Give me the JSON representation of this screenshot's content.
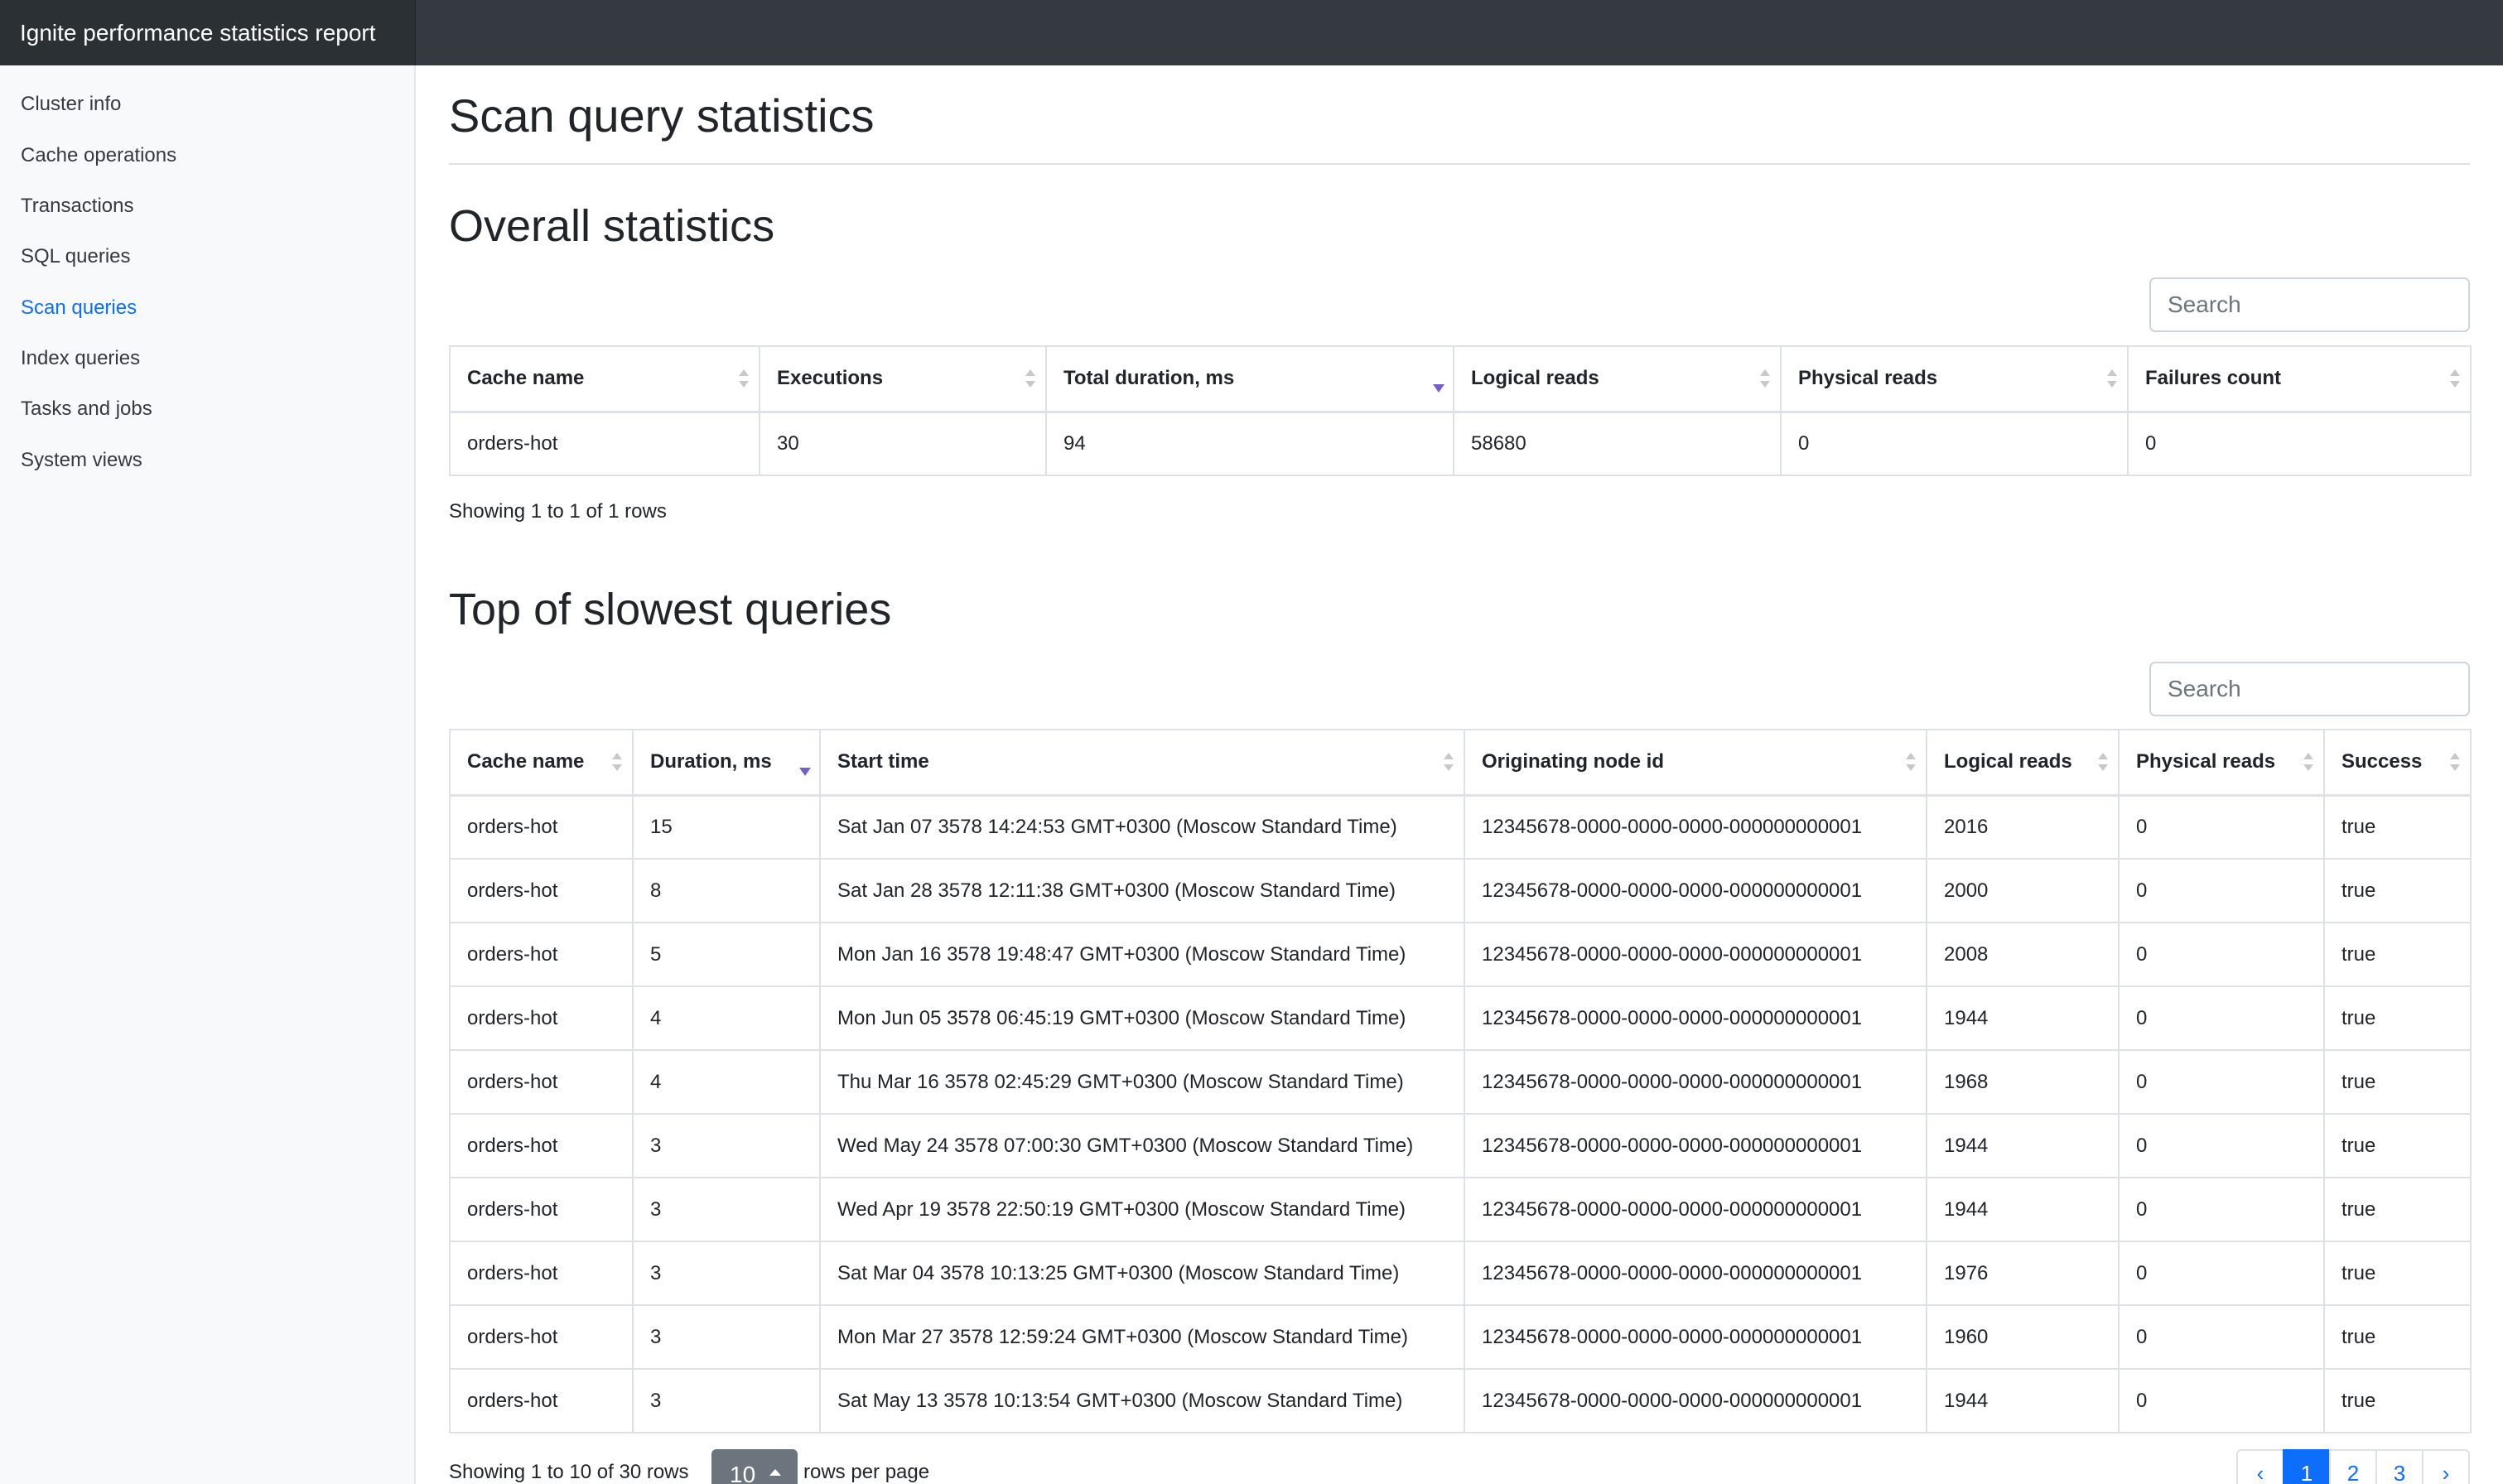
{
  "app": {
    "title": "Ignite performance statistics report"
  },
  "sidebar": {
    "items": [
      {
        "label": "Cluster info"
      },
      {
        "label": "Cache operations"
      },
      {
        "label": "Transactions"
      },
      {
        "label": "SQL queries"
      },
      {
        "label": "Scan queries",
        "active": true
      },
      {
        "label": "Index queries"
      },
      {
        "label": "Tasks and jobs"
      },
      {
        "label": "System views"
      }
    ]
  },
  "page": {
    "title": "Scan query statistics"
  },
  "overall": {
    "title": "Overall statistics",
    "search_placeholder": "Search",
    "columns": [
      "Cache name",
      "Executions",
      "Total duration, ms",
      "Logical reads",
      "Physical reads",
      "Failures count"
    ],
    "sorted_column": "Total duration, ms",
    "sort_direction": "desc",
    "rows": [
      [
        "orders-hot",
        "30",
        "94",
        "58680",
        "0",
        "0"
      ]
    ],
    "footer": "Showing 1 to 1 of 1 rows"
  },
  "slowest": {
    "title": "Top of slowest queries",
    "search_placeholder": "Search",
    "columns": [
      "Cache name",
      "Duration, ms",
      "Start time",
      "Originating node id",
      "Logical reads",
      "Physical reads",
      "Success"
    ],
    "sorted_column": "Duration, ms",
    "sort_direction": "desc",
    "rows": [
      [
        "orders-hot",
        "15",
        "Sat Jan 07 3578 14:24:53 GMT+0300 (Moscow Standard Time)",
        "12345678-0000-0000-0000-000000000001",
        "2016",
        "0",
        "true"
      ],
      [
        "orders-hot",
        "8",
        "Sat Jan 28 3578 12:11:38 GMT+0300 (Moscow Standard Time)",
        "12345678-0000-0000-0000-000000000001",
        "2000",
        "0",
        "true"
      ],
      [
        "orders-hot",
        "5",
        "Mon Jan 16 3578 19:48:47 GMT+0300 (Moscow Standard Time)",
        "12345678-0000-0000-0000-000000000001",
        "2008",
        "0",
        "true"
      ],
      [
        "orders-hot",
        "4",
        "Mon Jun 05 3578 06:45:19 GMT+0300 (Moscow Standard Time)",
        "12345678-0000-0000-0000-000000000001",
        "1944",
        "0",
        "true"
      ],
      [
        "orders-hot",
        "4",
        "Thu Mar 16 3578 02:45:29 GMT+0300 (Moscow Standard Time)",
        "12345678-0000-0000-0000-000000000001",
        "1968",
        "0",
        "true"
      ],
      [
        "orders-hot",
        "3",
        "Wed May 24 3578 07:00:30 GMT+0300 (Moscow Standard Time)",
        "12345678-0000-0000-0000-000000000001",
        "1944",
        "0",
        "true"
      ],
      [
        "orders-hot",
        "3",
        "Wed Apr 19 3578 22:50:19 GMT+0300 (Moscow Standard Time)",
        "12345678-0000-0000-0000-000000000001",
        "1944",
        "0",
        "true"
      ],
      [
        "orders-hot",
        "3",
        "Sat Mar 04 3578 10:13:25 GMT+0300 (Moscow Standard Time)",
        "12345678-0000-0000-0000-000000000001",
        "1976",
        "0",
        "true"
      ],
      [
        "orders-hot",
        "3",
        "Mon Mar 27 3578 12:59:24 GMT+0300 (Moscow Standard Time)",
        "12345678-0000-0000-0000-000000000001",
        "1960",
        "0",
        "true"
      ],
      [
        "orders-hot",
        "3",
        "Sat May 13 3578 10:13:54 GMT+0300 (Moscow Standard Time)",
        "12345678-0000-0000-0000-000000000001",
        "1944",
        "0",
        "true"
      ]
    ],
    "footer": {
      "showing": "Showing 1 to 10 of 30 rows",
      "rows_per_page_value": "10",
      "rows_per_page_label": "rows per page"
    },
    "pagination": {
      "prev": "‹",
      "pages": [
        "1",
        "2",
        "3"
      ],
      "active_page": "1",
      "next": "›"
    }
  },
  "colors": {
    "topbar": "#343a40",
    "sidebar_bg": "#f8f9fa",
    "active_link": "#0d6efd",
    "sort_active": "#6f61c9"
  }
}
